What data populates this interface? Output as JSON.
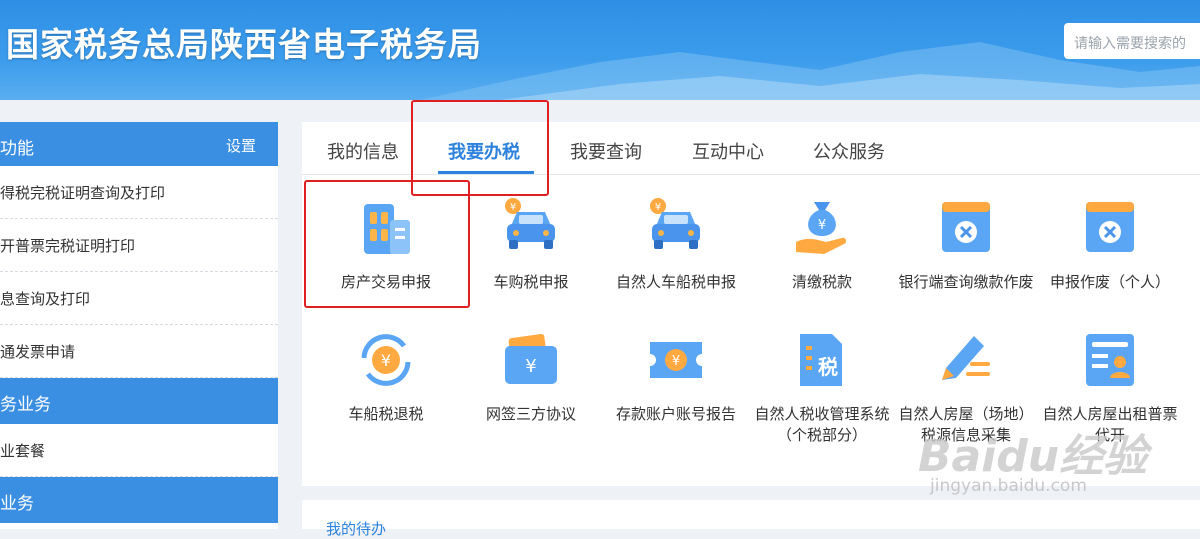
{
  "header": {
    "title": "国家税务总局陕西省电子税务局",
    "search_placeholder": "请输入需要搜索的"
  },
  "sidebar": {
    "head_title": "功能",
    "head_setting": "设置",
    "items": [
      "得税完税证明查询及打印",
      "开普票完税证明打印",
      "息查询及打印",
      "通发票申请"
    ],
    "section1": "务业务",
    "section1_items": [
      "业套餐"
    ],
    "section2": "业务"
  },
  "tabs": [
    {
      "label": "我的信息",
      "active": false
    },
    {
      "label": "我要办税",
      "active": true
    },
    {
      "label": "我要查询",
      "active": false
    },
    {
      "label": "互动中心",
      "active": false
    },
    {
      "label": "公众服务",
      "active": false
    }
  ],
  "services": [
    {
      "label": "房产交易申报",
      "icon": "building-icon"
    },
    {
      "label": "车购税申报",
      "icon": "car-icon"
    },
    {
      "label": "自然人车船税申报",
      "icon": "car-tax-icon"
    },
    {
      "label": "清缴税款",
      "icon": "money-bag-icon"
    },
    {
      "label": "银行端查询缴款作废",
      "icon": "cancel-doc-icon"
    },
    {
      "label": "申报作废（个人）",
      "icon": "cancel-doc-icon"
    },
    {
      "label": "车船税退税",
      "icon": "refund-icon"
    },
    {
      "label": "网签三方协议",
      "icon": "wallet-icon"
    },
    {
      "label": "存款账户账号报告",
      "icon": "ticket-icon"
    },
    {
      "label": "自然人税收管理系统（个税部分）",
      "icon": "tax-doc-icon"
    },
    {
      "label": "自然人房屋（场地）税源信息采集",
      "icon": "pen-icon"
    },
    {
      "label": "自然人房屋出租普票代开",
      "icon": "id-card-icon"
    }
  ],
  "bottom_tab": "我的待办",
  "watermark": {
    "brand": "Baidu经验",
    "url": "jingyan.baidu.com"
  },
  "colors": {
    "accent": "#2c82dc",
    "highlight": "#e02020"
  }
}
